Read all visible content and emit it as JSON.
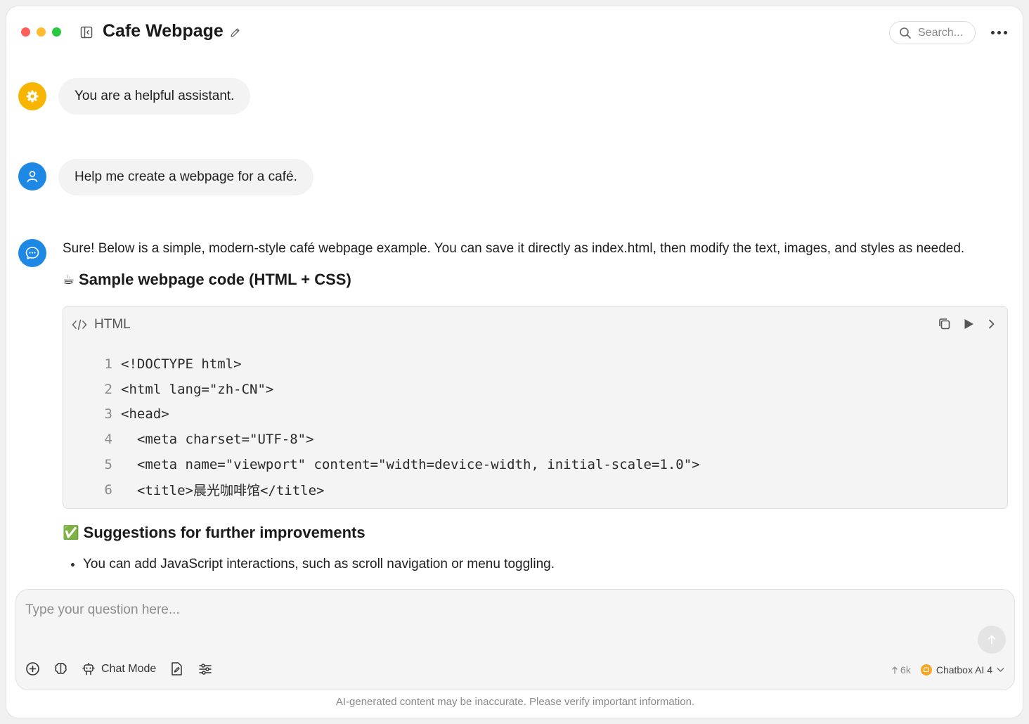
{
  "window": {
    "title": "Cafe Webpage",
    "traffic_colors": [
      "#ff5f57",
      "#febc2e",
      "#28c840"
    ]
  },
  "header": {
    "search_placeholder": "Search..."
  },
  "messages": {
    "system": {
      "text": "You are a helpful assistant.",
      "avatar_color": "#f7b500"
    },
    "user": {
      "text": "Help me create a webpage for a café.",
      "avatar_color": "#1e88e5"
    },
    "assistant": {
      "avatar_color": "#1e88e5",
      "intro": "Sure! Below is a simple, modern-style café webpage example. You can save it directly as index.html, then modify the text, images, and styles as needed.",
      "heading1_emoji": "☕",
      "heading1": "Sample webpage code (HTML + CSS)",
      "code": {
        "lang": "HTML",
        "lines": [
          {
            "n": "1",
            "text": "<!DOCTYPE html>"
          },
          {
            "n": "2",
            "text": "<html lang=\"zh-CN\">"
          },
          {
            "n": "3",
            "text": "<head>"
          },
          {
            "n": "4",
            "text": "  <meta charset=\"UTF-8\">"
          },
          {
            "n": "5",
            "text": "  <meta name=\"viewport\" content=\"width=device-width, initial-scale=1.0\">"
          },
          {
            "n": "6",
            "text": "  <title>晨光咖啡馆</title>"
          }
        ]
      },
      "heading2_emoji": "✅",
      "heading2": "Suggestions for further improvements",
      "bullets": [
        "You can add JavaScript interactions, such as scroll navigation or menu toggling."
      ]
    }
  },
  "input": {
    "placeholder": "Type your question here...",
    "chat_mode_label": "Chat Mode",
    "tokens": "6k",
    "model": "Chatbox AI 4"
  },
  "footer": {
    "disclaimer": "AI-generated content may be inaccurate. Please verify important information."
  }
}
